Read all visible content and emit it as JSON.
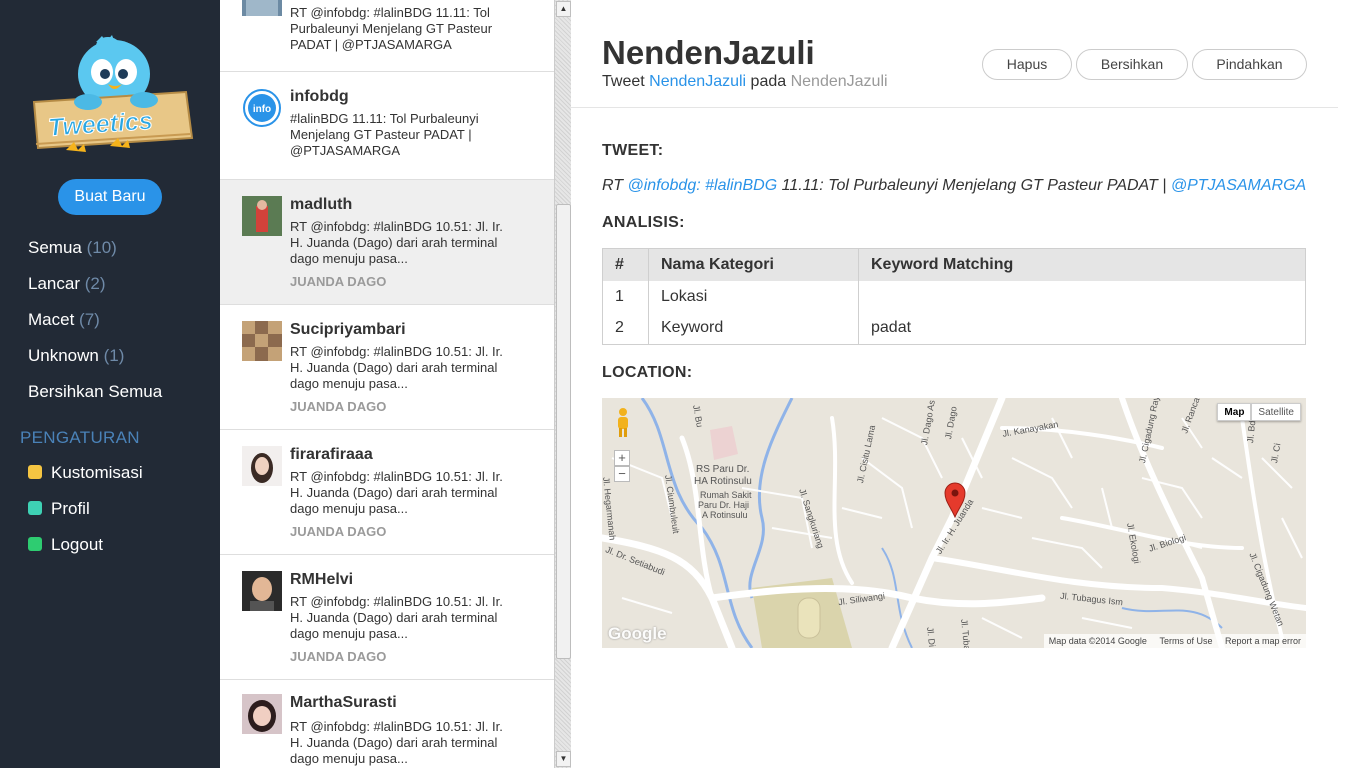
{
  "app": {
    "logo_text": "Tweetics",
    "new_button": "Buat Baru"
  },
  "nav": {
    "items": [
      {
        "label": "Semua",
        "count": "(10)"
      },
      {
        "label": "Lancar",
        "count": "(2)"
      },
      {
        "label": "Macet",
        "count": "(7)"
      },
      {
        "label": "Unknown",
        "count": "(1)"
      },
      {
        "label": "Bersihkan Semua",
        "count": ""
      }
    ]
  },
  "settings": {
    "heading": "PENGATURAN",
    "items": [
      {
        "label": "Kustomisasi",
        "color": "#f5c542"
      },
      {
        "label": "Profil",
        "color": "#3ed1b4"
      },
      {
        "label": "Logout",
        "color": "#2ecc71"
      }
    ]
  },
  "tweets": [
    {
      "name": "",
      "line1": "RT @infobdg: #lalinBDG 11.11: Tol",
      "line2": "Purbaleunyi Menjelang GT Pasteur",
      "line3": "PADAT | @PTJASAMARGA",
      "location": ""
    },
    {
      "name": "infobdg",
      "line1": "#lalinBDG 11.11: Tol Purbaleunyi",
      "line2": "Menjelang GT Pasteur PADAT |",
      "line3": "@PTJASAMARGA",
      "location": ""
    },
    {
      "name": "madluth",
      "line1": "RT @infobdg: #lalinBDG 10.51: Jl. Ir.",
      "line2": "H. Juanda (Dago) dari arah terminal",
      "line3": "dago menuju pasa...",
      "location": "JUANDA DAGO"
    },
    {
      "name": "Sucipriyambari",
      "line1": "RT @infobdg: #lalinBDG 10.51: Jl. Ir.",
      "line2": "H. Juanda (Dago) dari arah terminal",
      "line3": "dago menuju pasa...",
      "location": "JUANDA DAGO"
    },
    {
      "name": "firarafiraaa",
      "line1": "RT @infobdg: #lalinBDG 10.51: Jl. Ir.",
      "line2": "H. Juanda (Dago) dari arah terminal",
      "line3": "dago menuju pasa...",
      "location": "JUANDA DAGO"
    },
    {
      "name": "RMHelvi",
      "line1": "RT @infobdg: #lalinBDG 10.51: Jl. Ir.",
      "line2": "H. Juanda (Dago) dari arah terminal",
      "line3": "dago menuju pasa...",
      "location": "JUANDA DAGO"
    },
    {
      "name": "MarthaSurasti",
      "line1": "RT @infobdg: #lalinBDG 10.51: Jl. Ir.",
      "line2": "H. Juanda (Dago) dari arah terminal",
      "line3": "dago menuju pasa...",
      "location": ""
    }
  ],
  "detail": {
    "title": "NendenJazuli",
    "sub_prefix": "Tweet",
    "sub_user": "NendenJazuli",
    "sub_mid": "pada",
    "sub_place": "NendenJazuli",
    "actions": {
      "delete": "Hapus",
      "clear": "Bersihkan",
      "move": "Pindahkan"
    },
    "tweet_heading": "TWEET:",
    "tweet": {
      "prefix": "RT ",
      "mention": "@infobdg:",
      "space": " ",
      "hashtag": "#lalinBDG",
      "body": " 11.11: Tol Purbaleunyi Menjelang GT Pasteur PADAT | ",
      "mention2": "@PTJASAMARGA"
    },
    "analysis_heading": "ANALISIS:",
    "table": {
      "headers": [
        "#",
        "Nama Kategori",
        "Keyword Matching"
      ],
      "rows": [
        [
          "1",
          "Lokasi",
          ""
        ],
        [
          "2",
          "Keyword",
          "padat"
        ]
      ]
    },
    "location_heading": "LOCATION:"
  },
  "map": {
    "type_map": "Map",
    "type_satellite": "Satellite",
    "brand": "Google",
    "data_credit": "Map data ©2014 Google",
    "terms": "Terms of Use",
    "report": "Report a map error",
    "labels": {
      "rs_paru": "RS Paru Dr.",
      "rs_paru2": "HA Rotinsulu",
      "rs_sub1": "Rumah Sakit",
      "rs_sub2": "Paru Dr. Haji",
      "rs_sub3": "A Rotinsulu",
      "setiabudi": "Jl. Dr. Setiabudi",
      "siliwangi": "Jl. Siliwangi",
      "tubagus": "Jl. Tubagus Ism",
      "kanayakan": "Jl. Kanayakan",
      "cigadung": "Jl. Cigadung Raya",
      "juanda": "Jl. Ir. H. Juanda",
      "biologi": "Jl. Biologi",
      "ekologi": "Jl. Ekologi",
      "sangkuriang": "Jl. Sangkuriang",
      "cisitu": "Jl. Cisitu Lama",
      "ciumbuleuit": "Jl. Ciumbuleuit",
      "hegarmanah": "Jl. Hegarmanah",
      "dago_as": "Jl. Dago As",
      "dago": "Jl. Dago",
      "bu": "Jl. Bu",
      "ranca": "Jl. Ranca",
      "bd": "Jl. Bd",
      "ci": "Jl. Ci",
      "cigadung_wetan": "Jl. Cigadung Wetan",
      "di": "Jl. Di",
      "tubagus_v": "Jl. Tubag"
    }
  }
}
